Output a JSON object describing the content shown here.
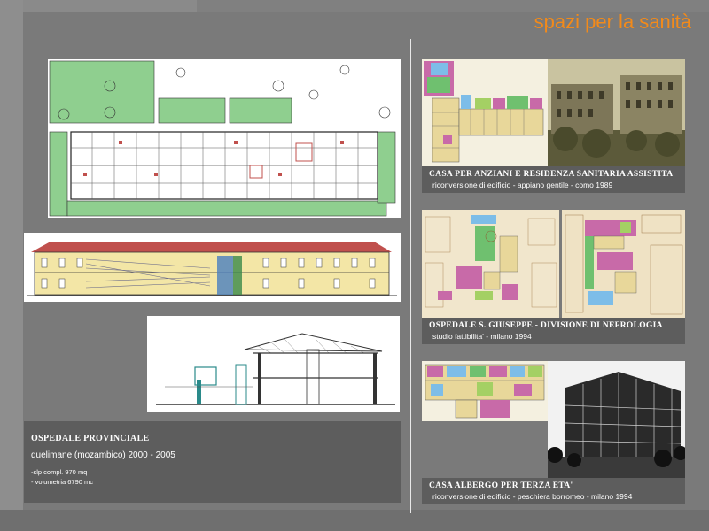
{
  "page": {
    "title": "spazi per la sanità"
  },
  "projects": [
    {
      "title": "OSPEDALE PROVINCIALE",
      "subtitle": "quelimane (mozambico) 2000 - 2005",
      "notes": [
        "-slp compl. 970 mq",
        "- volumetria 6790 mc"
      ]
    },
    {
      "title": "CASA  PER  ANZIANI E RESIDENZA SANITARIA  ASSISTITA",
      "subtitle": "riconversione di edificio - appiano gentile - como 1989"
    },
    {
      "title": "OSPEDALE S. GIUSEPPE - DIVISIONE DI NEFROLOGIA",
      "subtitle": "studio  fattibilita' - milano 1994"
    },
    {
      "title": "CASA  ALBERGO PER TERZA ETA'",
      "subtitle": "riconversione di edificio - peschiera borromeo - milano 1994"
    }
  ],
  "colors": {
    "title": "#f28a1a",
    "background": "#7a7a7a",
    "caption_bg": "#5d5d5d",
    "lawn": "#8fcf8f",
    "roof": "#c0504d",
    "facade": "#f3e6a6"
  }
}
